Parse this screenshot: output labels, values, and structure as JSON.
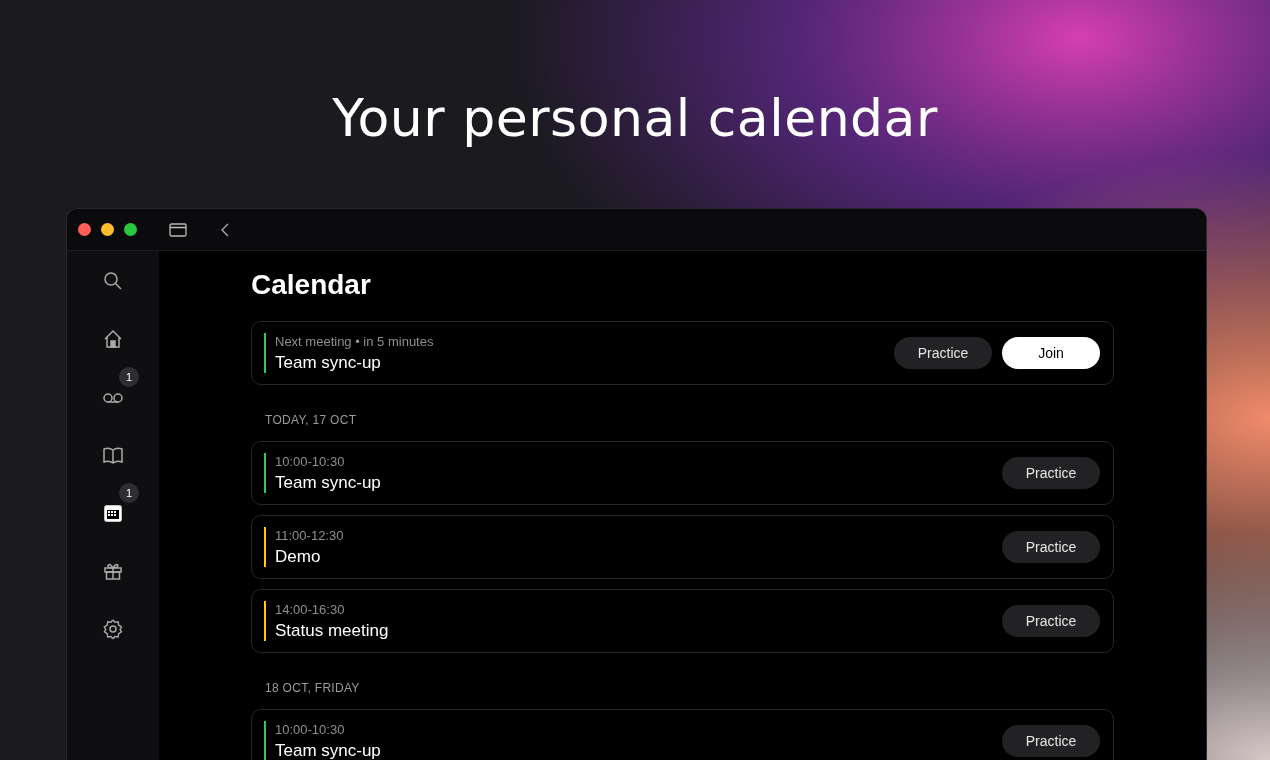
{
  "headline": "Your personal calendar",
  "sidebar": {
    "items": [
      {
        "kind": "search",
        "selected": false
      },
      {
        "kind": "home",
        "selected": false
      },
      {
        "kind": "voicemail",
        "selected": false,
        "badge": "1"
      },
      {
        "kind": "book",
        "selected": false
      },
      {
        "kind": "calendar",
        "selected": true,
        "badge": "1"
      },
      {
        "kind": "gift",
        "selected": false
      },
      {
        "kind": "settings",
        "selected": false
      }
    ]
  },
  "page_title": "Calendar",
  "next_meeting": {
    "label": "Next meeting • in 5 minutes",
    "title": "Team sync-up",
    "color": "#34c759",
    "buttons": [
      {
        "label": "Practice",
        "kind": "secondary"
      },
      {
        "label": "Join",
        "kind": "primary"
      }
    ]
  },
  "days": [
    {
      "heading": "TODAY, 17 OCT",
      "events": [
        {
          "time": "10:00-10:30",
          "title": "Team sync-up",
          "color": "#34c759",
          "button": "Practice"
        },
        {
          "time": "11:00-12:30",
          "title": "Demo",
          "color": "#ffcc00",
          "button": "Practice"
        },
        {
          "time": "14:00-16:30",
          "title": "Status meeting",
          "color": "#ffcc00",
          "button": "Practice"
        }
      ]
    },
    {
      "heading": "18 OCT, FRIDAY",
      "events": [
        {
          "time": "10:00-10:30",
          "title": "Team sync-up",
          "color": "#34c759",
          "button": "Practice"
        }
      ]
    }
  ]
}
